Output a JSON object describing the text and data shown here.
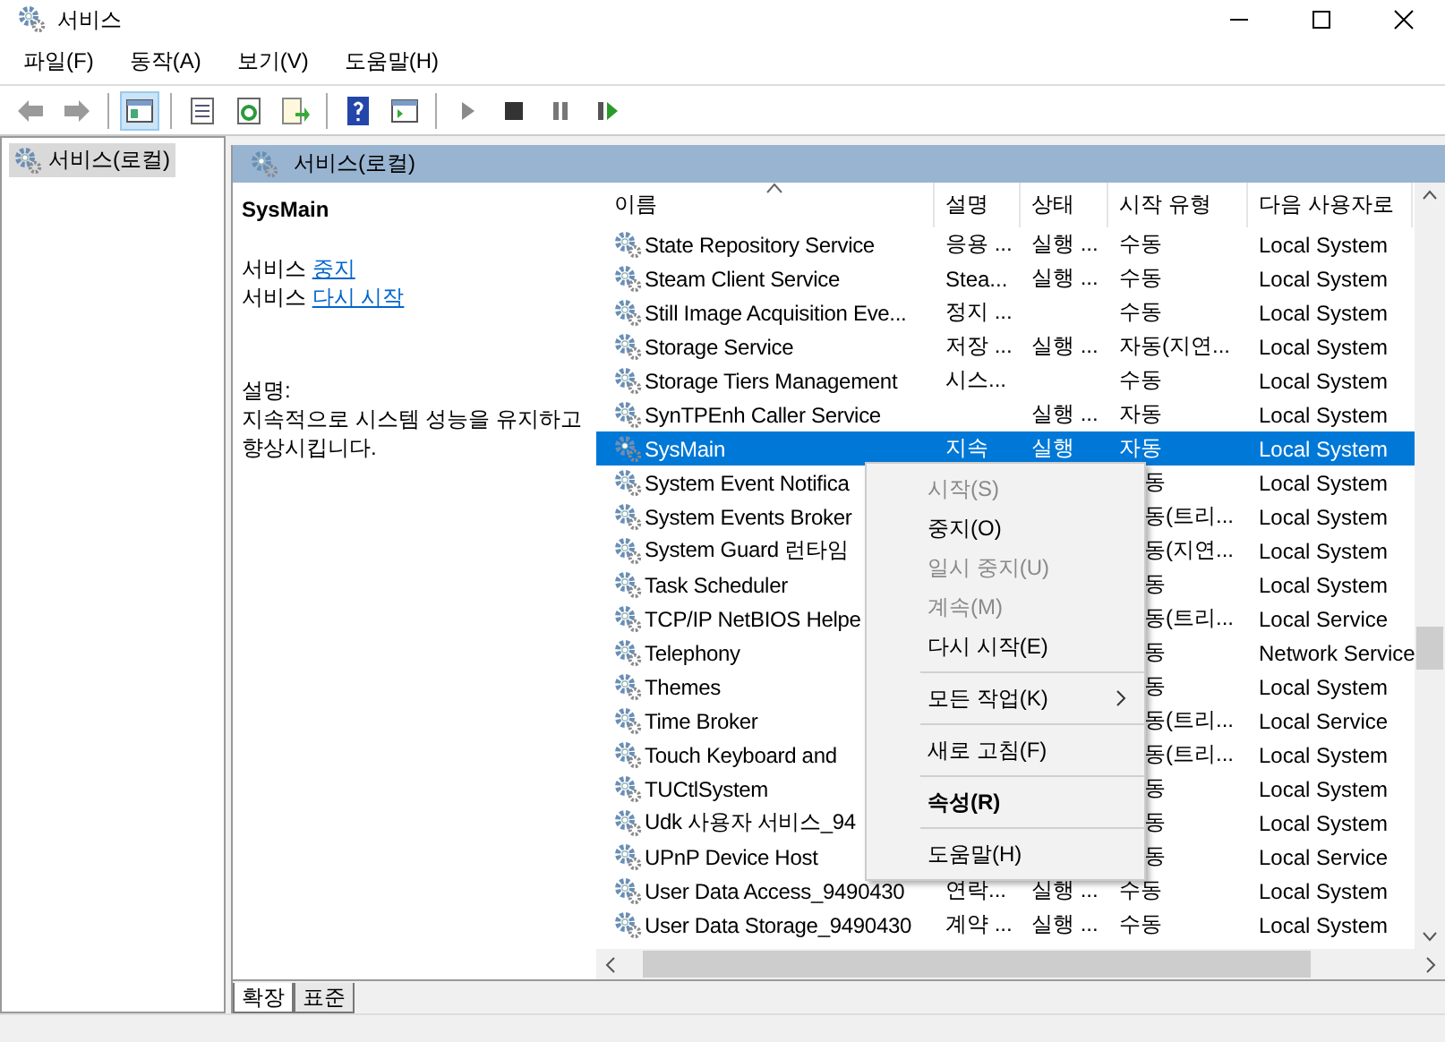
{
  "window": {
    "title": "서비스"
  },
  "menu_bar": [
    "파일(F)",
    "동작(A)",
    "보기(V)",
    "도움말(H)"
  ],
  "tree": {
    "items": [
      {
        "label": "서비스(로컬)",
        "selected": true
      }
    ]
  },
  "pane": {
    "header": "서비스(로컬)",
    "service_name": "SysMain",
    "links": [
      {
        "prefix": "서비스",
        "link": "중지"
      },
      {
        "prefix": "서비스",
        "link": "다시 시작"
      }
    ],
    "description_label": "설명:",
    "description": "지속적으로 시스템 성능을 유지하고 향상시킵니다."
  },
  "table": {
    "columns": [
      {
        "label": "이름",
        "sorted": true
      },
      {
        "label": "설명",
        "sorted": false
      },
      {
        "label": "상태",
        "sorted": false
      },
      {
        "label": "시작 유형",
        "sorted": false
      },
      {
        "label": "다음 사용자로",
        "sorted": false
      }
    ],
    "rows": [
      {
        "kind": "plain",
        "selected": false,
        "name": "State Repository Service",
        "description": "응용 ...",
        "status": "실행 ...",
        "startup": "수동",
        "logon": "Local System"
      },
      {
        "kind": "plain",
        "selected": false,
        "name": "Steam Client Service",
        "description": "Stea...",
        "status": "실행 ...",
        "startup": "수동",
        "logon": "Local System"
      },
      {
        "kind": "plain",
        "selected": false,
        "name": "Still Image Acquisition Eve...",
        "description": "정지 ...",
        "startup": "수동",
        "logon": "Local System"
      },
      {
        "kind": "plain",
        "selected": false,
        "name": "Storage Service",
        "description": "저장 ...",
        "status": "실행 ...",
        "startup": "자동(지연...",
        "logon": "Local System"
      },
      {
        "kind": "plain",
        "selected": false,
        "name": "Storage Tiers Management",
        "description": "시스...",
        "startup": "수동",
        "logon": "Local System"
      },
      {
        "kind": "plain",
        "selected": false,
        "name": "SynTPEnh Caller Service",
        "status": "실행 ...",
        "startup": "자동",
        "logon": "Local System"
      },
      {
        "kind": "plain",
        "selected": true,
        "name": "SysMain",
        "description": "지속",
        "status": "실행",
        "startup": "자동",
        "logon": "Local System"
      },
      {
        "kind": "covered",
        "selected": false,
        "name": "System Event Notifica",
        "startup": "동",
        "logon": "Local System"
      },
      {
        "kind": "covered",
        "selected": false,
        "name": "System Events Broker",
        "startup": "동(트리...",
        "logon": "Local System"
      },
      {
        "kind": "covered",
        "selected": false,
        "name": "System Guard 런타임",
        "startup": "동(지연...",
        "logon": "Local System"
      },
      {
        "kind": "covered",
        "selected": false,
        "name": "Task Scheduler",
        "startup": "동",
        "logon": "Local System"
      },
      {
        "kind": "covered",
        "selected": false,
        "name": "TCP/IP NetBIOS Helpe",
        "startup": "동(트리...",
        "logon": "Local Service"
      },
      {
        "kind": "covered",
        "selected": false,
        "name": "Telephony",
        "startup": "동",
        "logon": "Network Service"
      },
      {
        "kind": "covered",
        "selected": false,
        "name": "Themes",
        "startup": "동",
        "logon": "Local System"
      },
      {
        "kind": "covered",
        "selected": false,
        "name": "Time Broker",
        "startup": "동(트리...",
        "logon": "Local Service"
      },
      {
        "kind": "covered",
        "selected": false,
        "name": "Touch Keyboard and",
        "startup": "동(트리...",
        "logon": "Local System"
      },
      {
        "kind": "covered",
        "selected": false,
        "name": "TUCtlSystem",
        "startup": "동",
        "logon": "Local System"
      },
      {
        "kind": "covered",
        "selected": false,
        "name": "Udk 사용자 서비스_94",
        "startup": "동",
        "logon": "Local System"
      },
      {
        "kind": "covered",
        "selected": false,
        "name": "UPnP Device Host",
        "startup": "동",
        "logon": "Local Service"
      },
      {
        "kind": "plain",
        "selected": false,
        "name": "User Data Access_9490430",
        "description": "연락...",
        "status": "실행 ...",
        "startup": "수동",
        "logon": "Local System"
      },
      {
        "kind": "plain",
        "selected": false,
        "name": "User Data Storage_9490430",
        "description": "계약 ...",
        "status": "실행 ...",
        "startup": "수동",
        "logon": "Local System"
      }
    ]
  },
  "context_menu": {
    "items": [
      {
        "kind": "item",
        "label": "시작(S)",
        "disabled": true,
        "bold": false,
        "submenu": false
      },
      {
        "kind": "item",
        "label": "중지(O)",
        "disabled": false,
        "bold": false,
        "submenu": false
      },
      {
        "kind": "item",
        "label": "일시 중지(U)",
        "disabled": true,
        "bold": false,
        "submenu": false
      },
      {
        "kind": "item",
        "label": "계속(M)",
        "disabled": true,
        "bold": false,
        "submenu": false
      },
      {
        "kind": "item",
        "label": "다시 시작(E)",
        "disabled": false,
        "bold": false,
        "submenu": false
      },
      {
        "kind": "separator"
      },
      {
        "kind": "item",
        "label": "모든 작업(K)",
        "disabled": false,
        "bold": false,
        "submenu": true
      },
      {
        "kind": "separator"
      },
      {
        "kind": "item",
        "label": "새로 고침(F)",
        "disabled": false,
        "bold": false,
        "submenu": false
      },
      {
        "kind": "separator"
      },
      {
        "kind": "item",
        "label": "속성(R)",
        "disabled": false,
        "bold": true,
        "submenu": false
      },
      {
        "kind": "separator"
      },
      {
        "kind": "item",
        "label": "도움말(H)",
        "disabled": false,
        "bold": false,
        "submenu": false
      }
    ]
  },
  "bottom_tabs": [
    {
      "label": "확장",
      "selected": true
    },
    {
      "label": "표준",
      "selected": false
    }
  ]
}
